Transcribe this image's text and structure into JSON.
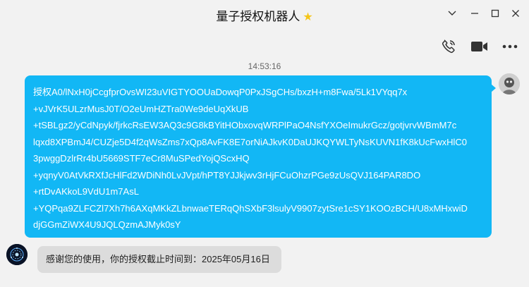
{
  "window": {
    "title": "量子授权机器人",
    "title_badge_icon": "star-icon",
    "controls": [
      "chevron-down-icon",
      "minimize-icon",
      "maximize-icon",
      "close-icon"
    ]
  },
  "toolbar": {
    "icons": [
      "phone-icon",
      "video-camera-icon",
      "more-icon"
    ]
  },
  "chat": {
    "timestamp": "14:53:16",
    "outgoing": {
      "lines": [
        "授权A0/lNxH0jCcgfprOvsWI23uVIGTYOOUaDowqP0PxJSgCHs/bxzH+m8Fwa/5Lk1VYqq7x",
        "+vJVrK5ULzrMusJ0T/O2eUmHZTra0We9deUqXkUB",
        "+tSBLgz2/yCdNpyk/fjrkcRsEW3AQ3c9G8kBYitHObxovqWRPlPaO4NsfYXOeImukrGcz/gotjvrvWBmM7c",
        "lqxd8XPBmJ4/CUZje5D4f2qWsZms7xQp8AvFK8E7orNiAJkvK0DaUJKQYWLTyNsKUVN1fK8kUcFwxHlC0",
        "3pwggDzlrRr4bU5669STF7eCr8MuSPedYojQScxHQ",
        "+yqnyV0AtVkRXfJcHlFd2WDiNh0LvJVpt/hPT8YJJkjwv3rHjFCuOhzrPGe9zUsQVJ164PAR8DO",
        "+rtDvAKkoL9VdU1m7AsL",
        "+YQPqa9ZLFCZl7Xh7h6AXqMKkZLbnwaeTERqQhSXbF3lsulyV9907zytSre1cSY1KOOzBCH/U8xMHxwiD",
        "djGGmZiWX4U9JQLQzmAJMyk0sY"
      ]
    },
    "incoming": {
      "text": "感谢您的使用，你的授权截止时间到：2025年05月16日"
    }
  },
  "colors": {
    "outgoing_bubble": "#12b7f5",
    "incoming_bubble": "#dcdcdc",
    "background": "#f2f2f2"
  }
}
